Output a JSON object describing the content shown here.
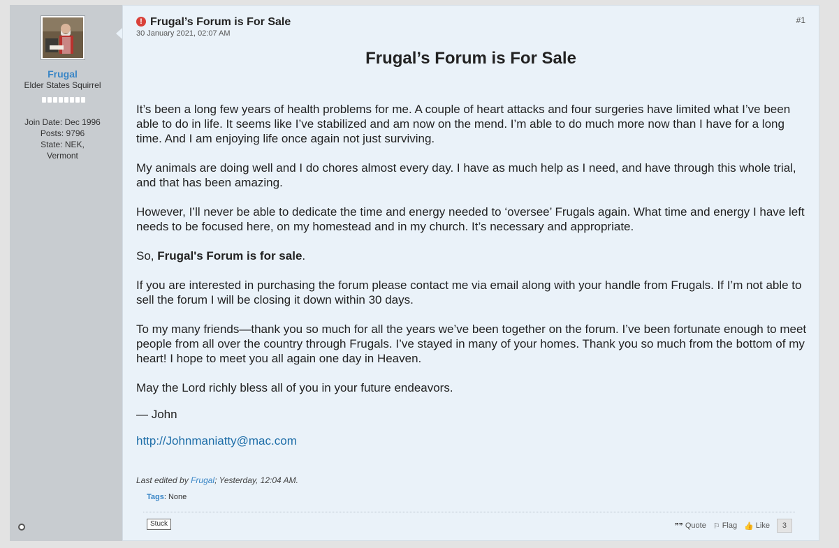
{
  "user": {
    "name": "Frugal",
    "title": "Elder States Squirrel",
    "join_date": "Join Date: Dec 1996",
    "posts": "Posts: 9796",
    "state_line1": "State: NEK,",
    "state_line2": "Vermont"
  },
  "post": {
    "title": "Frugal’s Forum is For Sale",
    "date": "30 January 2021, 02:07 AM",
    "number": "#1",
    "headline": "Frugal’s Forum is For Sale",
    "paragraphs": [
      "It’s been a long few years of health problems for me. A couple of heart attacks and four surgeries have limited what I’ve been able to do in life. It seems like I’ve stabilized and am now on the mend. I’m able to do much more now than I have for a long time. And I am enjoying life once again not just surviving.",
      "My animals are doing well and I do chores almost every day. I have as much help as I need, and have through this whole trial, and that has been amazing.",
      "However, I’ll never be able to dedicate the time and energy needed to ‘oversee’ Frugals again. What time and energy I have left needs to be focused here, on my homestead and in my church. It’s necessary and appropriate."
    ],
    "sale_prefix": "So, ",
    "sale_bold": "Frugal's Forum is for sale",
    "sale_suffix": ".",
    "paragraphs2": [
      "If you are interested in purchasing the forum please contact me via email along with your handle from Frugals. If I’m not able to sell the forum I will be closing it down within 30 days.",
      "To my many friends—thank you so much for all the years we’ve been together on the forum. I’ve been fortunate enough to meet people from all over the country through Frugals. I’ve stayed in many of your homes. Thank you so much from the bottom of my heart! I hope to meet you all again one day in Heaven.",
      "May the Lord richly bless all of you in your future endeavors."
    ],
    "signature": "— John",
    "email_link": "http://Johnmaniatty@mac.com",
    "edited_prefix": "Last edited by ",
    "edited_user": "Frugal",
    "edited_suffix": "; Yesterday, 12:04 AM.",
    "tags_label": "Tags",
    "tags_value": ": None",
    "stuck_label": "Stuck",
    "actions": {
      "quote": "Quote",
      "flag": "Flag",
      "like": "Like",
      "like_count": "3"
    }
  },
  "colors": {
    "post_bg": "#eaf2f9",
    "sidebar_bg": "#c8ccd0",
    "link": "#3a86c6",
    "alert": "#d9413a"
  }
}
